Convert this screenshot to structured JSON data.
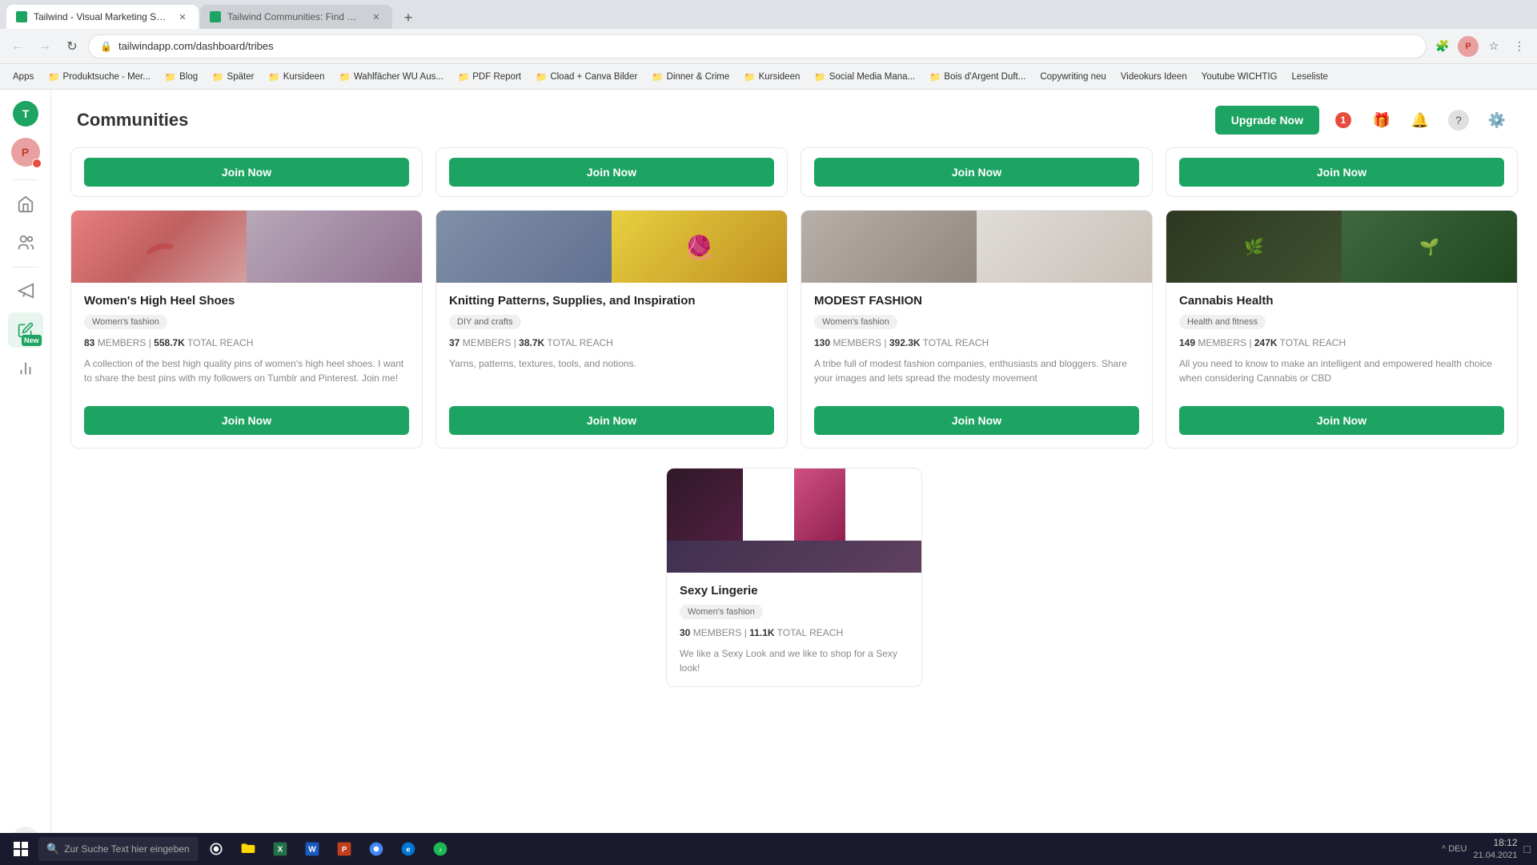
{
  "browser": {
    "tabs": [
      {
        "id": "tab1",
        "title": "Tailwind - Visual Marketing Suite...",
        "active": true,
        "favicon_color": "#1da462"
      },
      {
        "id": "tab2",
        "title": "Tailwind Communities: Find Gre...",
        "active": false,
        "favicon_color": "#1da462"
      }
    ],
    "address": "tailwindapp.com/dashboard/tribes",
    "bookmarks": [
      "Apps",
      "Produktsuche - Mer...",
      "Blog",
      "Später",
      "Kursideen",
      "Wahlfächer WU Aus...",
      "PDF Report",
      "Cload + Canva Bilder",
      "Dinner & Crime",
      "Kursideen",
      "Social Media Mana...",
      "Bois d'Argent Duft...",
      "Copywriting neu",
      "Videokurs Ideen",
      "Youtube WICHTIG",
      "Leseliste"
    ]
  },
  "page": {
    "title": "Communities",
    "upgrade_label": "Upgrade Now"
  },
  "sidebar": {
    "items": [
      {
        "name": "home",
        "icon": "🏠"
      },
      {
        "name": "audience",
        "icon": "👥"
      },
      {
        "name": "marketing",
        "icon": "📢"
      },
      {
        "name": "new",
        "icon": "✏️",
        "badge": "New"
      },
      {
        "name": "analytics",
        "icon": "📊"
      }
    ]
  },
  "header_icons": {
    "gift_label": "🎁",
    "notification_label": "🔔",
    "notification_count": "1",
    "help_label": "?",
    "settings_label": "⚙️",
    "profile_label": "P"
  },
  "partial_row": [
    {
      "join_label": "Join Now"
    },
    {
      "join_label": "Join Now"
    },
    {
      "join_label": "Join Now"
    },
    {
      "join_label": "Join Now"
    }
  ],
  "communities": [
    {
      "id": "womens-high-heel",
      "title": "Women's High Heel Shoes",
      "tag": "Women's fashion",
      "members": "83",
      "reach": "558.7K",
      "description": "A collection of the best high quality pins of women's high heel shoes. I want to share the best pins with my followers on Tumblr and Pinterest. Join me!",
      "join_label": "Join Now",
      "img_type": "fashion"
    },
    {
      "id": "knitting-patterns",
      "title": "Knitting Patterns, Supplies, and Inspiration",
      "tag": "DIY and crafts",
      "members": "37",
      "reach": "38.7K",
      "description": "Yarns, patterns, textures, tools, and notions.",
      "join_label": "Join Now",
      "img_type": "knit"
    },
    {
      "id": "modest-fashion",
      "title": "MODEST FASHION",
      "tag": "Women's fashion",
      "members": "130",
      "reach": "392.3K",
      "description": "A tribe full of modest fashion companies, enthusiasts and bloggers. Share your images and lets spread the modesty movement",
      "join_label": "Join Now",
      "img_type": "modest"
    },
    {
      "id": "cannabis-health",
      "title": "Cannabis Health",
      "tag": "Health and fitness",
      "members": "149",
      "reach": "247K",
      "description": "All you need to know to make an intelligent and empowered health choice when considering Cannabis or CBD",
      "join_label": "Join Now",
      "img_type": "cannabis"
    }
  ],
  "bottom_card": {
    "title": "Sexy Lingerie",
    "tag": "Women's fashion",
    "members": "30",
    "reach": "11.1K",
    "description": "We like a Sexy Look and we like to shop for a Sexy look!",
    "join_label": "Join Now",
    "img_type": "lingerie"
  },
  "taskbar": {
    "search_placeholder": "Zur Suche Text hier eingeben",
    "time": "18:12",
    "date": "21.04.2021",
    "lang": "DEU"
  }
}
